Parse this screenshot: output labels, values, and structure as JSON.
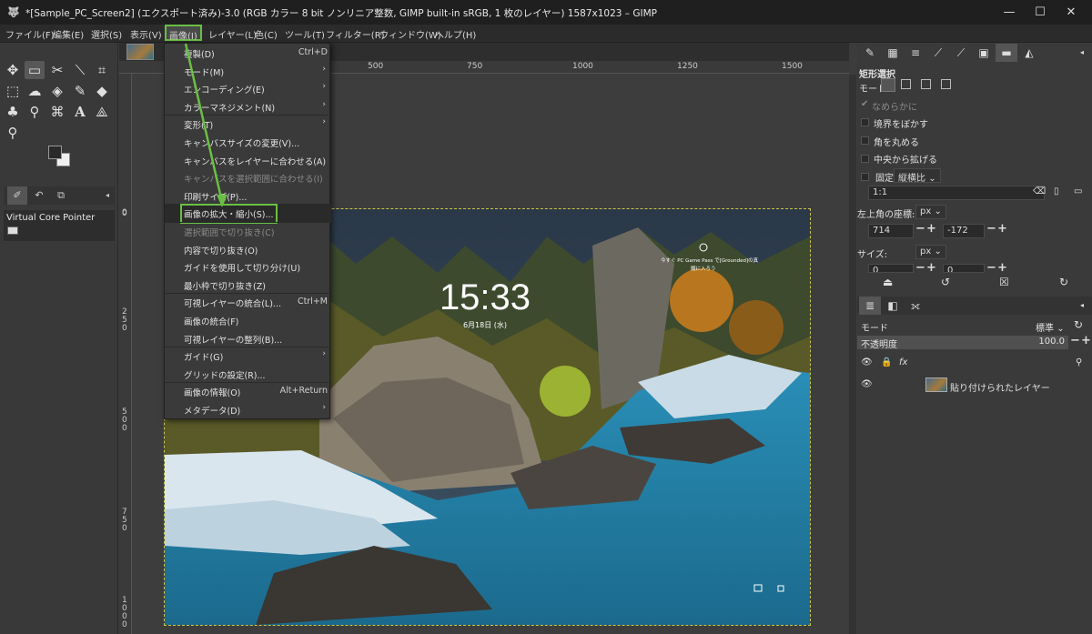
{
  "window": {
    "title": "*[Sample_PC_Screen2] (エクスポート済み)-3.0 (RGB カラー 8 bit ノンリニア整数, GIMP built-in sRGB, 1 枚のレイヤー) 1587x1023 – GIMP",
    "minimize": "—",
    "maximize": "☐",
    "close": "✕"
  },
  "menubar": [
    "ファイル(F)",
    "編集(E)",
    "選択(S)",
    "表示(V)",
    "画像(I)",
    "レイヤー(L)",
    "色(C)",
    "ツール(T)",
    "フィルター(R)",
    "ウィンドウ(W)",
    "ヘルプ(H)"
  ],
  "image_menu": {
    "items": [
      {
        "label": "複製(D)",
        "shortcut": "Ctrl+D"
      },
      {
        "label": "モード(M)",
        "submenu": "›"
      },
      {
        "label": "エンコーディング(E)",
        "submenu": "›"
      },
      {
        "label": "カラーマネジメント(N)",
        "submenu": "›"
      },
      {
        "label": "変形(T)",
        "submenu": "›"
      },
      {
        "label": "キャンバスサイズの変更(V)..."
      },
      {
        "label": "キャンバスをレイヤーに合わせる(A)"
      },
      {
        "label": "キャンバスを選択範囲に合わせる(I)"
      },
      {
        "label": "印刷サイズ(P)..."
      },
      {
        "label": "画像の拡大・縮小(S)..."
      },
      {
        "label": "選択範囲で切り抜き(C)"
      },
      {
        "label": "内容で切り抜き(O)"
      },
      {
        "label": "ガイドを使用して切り分け(U)"
      },
      {
        "label": "最小枠で切り抜き(Z)"
      },
      {
        "label": "可視レイヤーの統合(L)...",
        "shortcut": "Ctrl+M"
      },
      {
        "label": "画像の統合(F)"
      },
      {
        "label": "可視レイヤーの整列(B)..."
      },
      {
        "label": "ガイド(G)",
        "submenu": "›"
      },
      {
        "label": "グリッドの設定(R)..."
      },
      {
        "label": "画像の情報(O)",
        "shortcut": "Alt+Return"
      },
      {
        "label": "メタデータ(D)",
        "submenu": "›"
      }
    ]
  },
  "rulers": {
    "top": [
      "500",
      "750",
      "1000",
      "1250",
      "1500"
    ],
    "left": [
      "0",
      "2 5 0",
      "5 0 0",
      "7 5 0",
      "1 0 0 0"
    ],
    "canvas_top_left": "0",
    "dock_left": "0"
  },
  "toolbox": {
    "device_status": "Virtual Core Pointer"
  },
  "tool_options": {
    "title": "矩形選択",
    "mode_label": "モード:",
    "antialias": "なめらかに",
    "feather": "境界をぼかす",
    "rounded": "角を丸める",
    "expand_center": "中央から拡げる",
    "fixed": "固定",
    "fixed_value": "縦横比",
    "ratio": "1:1",
    "position_label": "左上角の座標:",
    "position_unit": "px",
    "pos_x": "714",
    "pos_y": "-172",
    "size_label": "サイズ:",
    "size_unit": "px",
    "size_w": "0",
    "size_h": "0"
  },
  "layers": {
    "mode_label": "モード",
    "mode_value": "標準",
    "opacity_label": "不透明度",
    "opacity_value": "100.0",
    "layer_name": "貼り付けられたレイヤー"
  },
  "photo": {
    "clock": "15:33",
    "date": "6月18日 (水)",
    "widget_text": "今すぐ PC Game Pass で[Grounded]の真髄に入ろう"
  }
}
